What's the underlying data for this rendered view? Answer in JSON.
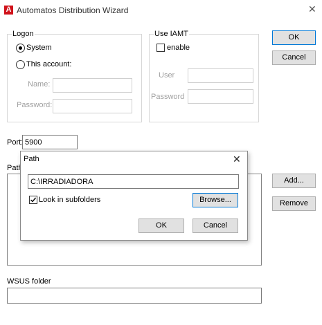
{
  "window": {
    "title": "Automatos Distribution Wizard",
    "icon": "automatos-logo-icon",
    "accent": "#d0121a"
  },
  "logon": {
    "legend": "Logon",
    "system_label": "System",
    "system_selected": true,
    "account_label": "This account:",
    "account_selected": false,
    "name_label": "Name:",
    "name_value": "",
    "password_label": "Password:",
    "password_value": ""
  },
  "iamt": {
    "legend": "Use IAMT",
    "enable_label": "enable",
    "enable_checked": false,
    "user_label": "User",
    "user_value": "",
    "password_label": "Password",
    "password_value": ""
  },
  "main_buttons": {
    "ok": "OK",
    "cancel": "Cancel",
    "add": "Add...",
    "remove": "Remove"
  },
  "port": {
    "label": "Port:",
    "value": "5900"
  },
  "paths_label": "Path",
  "wsus": {
    "label": "WSUS folder",
    "value": ""
  },
  "path_dialog": {
    "title": "Path",
    "close_icon": "close-icon",
    "path_value": "C:\\IRRADIADORA",
    "subfolders_label": "Look in subfolders",
    "subfolders_checked": true,
    "browse": "Browse...",
    "ok": "OK",
    "cancel": "Cancel"
  }
}
